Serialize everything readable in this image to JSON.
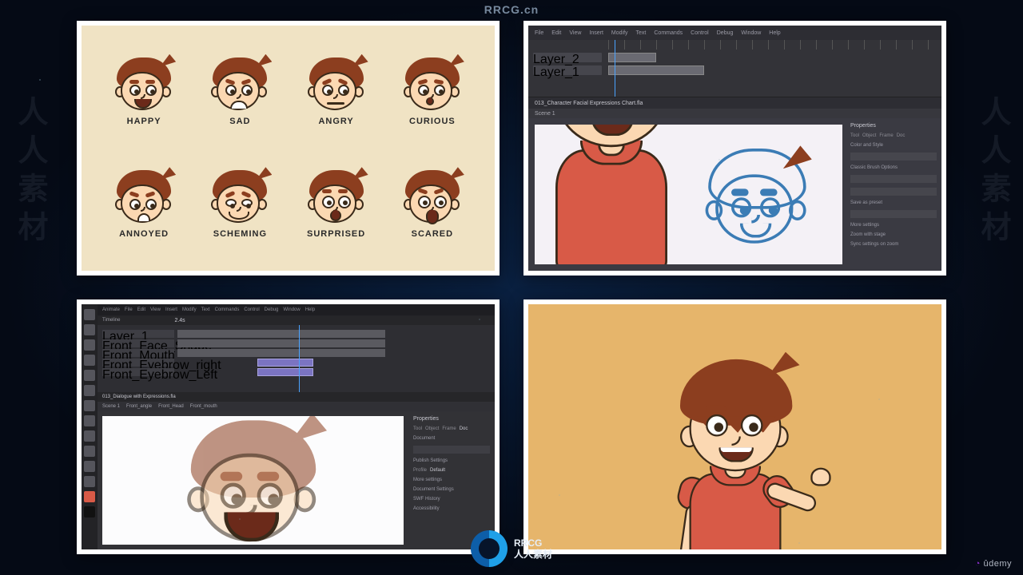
{
  "watermarks": {
    "top": "RRCG.cn",
    "side": "人人素材",
    "brand_main": "RRCG",
    "brand_sub": "人人素材",
    "platform": "ûdemy"
  },
  "expression_chart": {
    "row1": [
      {
        "label": "HAPPY"
      },
      {
        "label": "SAD"
      },
      {
        "label": "ANGRY"
      },
      {
        "label": "CURIOUS"
      }
    ],
    "row2": [
      {
        "label": "ANNOYED"
      },
      {
        "label": "SCHEMING"
      },
      {
        "label": "SURPRISED"
      },
      {
        "label": "SCARED"
      }
    ]
  },
  "animate_app_tr": {
    "menu": [
      "File",
      "Edit",
      "View",
      "Insert",
      "Modify",
      "Text",
      "Commands",
      "Control",
      "Debug",
      "Window",
      "Help"
    ],
    "timeline_layers": [
      "Layer_2",
      "Layer_1"
    ],
    "document_tab": "013_Character Facial Expressions Chart.fla",
    "scene_crumb": "Scene 1",
    "properties_title": "Properties",
    "properties_tabs": [
      "Tool",
      "Object",
      "Frame",
      "Doc"
    ],
    "section_color": "Color and Style",
    "brush_label": "Classic Brush Options",
    "preset_label": "Save as preset",
    "more_settings": "More settings",
    "zoom_stage": "Zoom with stage",
    "sync_settings": "Sync settings on zoom"
  },
  "animate_app_bl": {
    "menu": [
      "Animate",
      "File",
      "Edit",
      "View",
      "Insert",
      "Modify",
      "Text",
      "Commands",
      "Control",
      "Debug",
      "Window",
      "Help"
    ],
    "timeline_panel": "Timeline",
    "playhead_time": "2.4s",
    "timeline_layers": [
      "Layer_1",
      "Front_Face_Shape",
      "Front_Mouth",
      "Front_Eyebrow_right",
      "Front_Eyebrow_Left"
    ],
    "document_tab": "013_Dialogue with Expressions.fla",
    "scene_crumb": "Scene 1",
    "breadcrumb": [
      "Front_angle",
      "Front_Head",
      "Front_mouth"
    ],
    "properties_title": "Properties",
    "properties_tabs": [
      "Tool",
      "Object",
      "Frame",
      "Doc"
    ],
    "doc_label": "Document",
    "publish_section": "Publish Settings",
    "profile_label": "Profile",
    "profile_value": "Default",
    "more_settings": "More settings",
    "doc_settings": "Document Settings",
    "swf_history": "SWF History",
    "accessibility": "Accessibility"
  }
}
